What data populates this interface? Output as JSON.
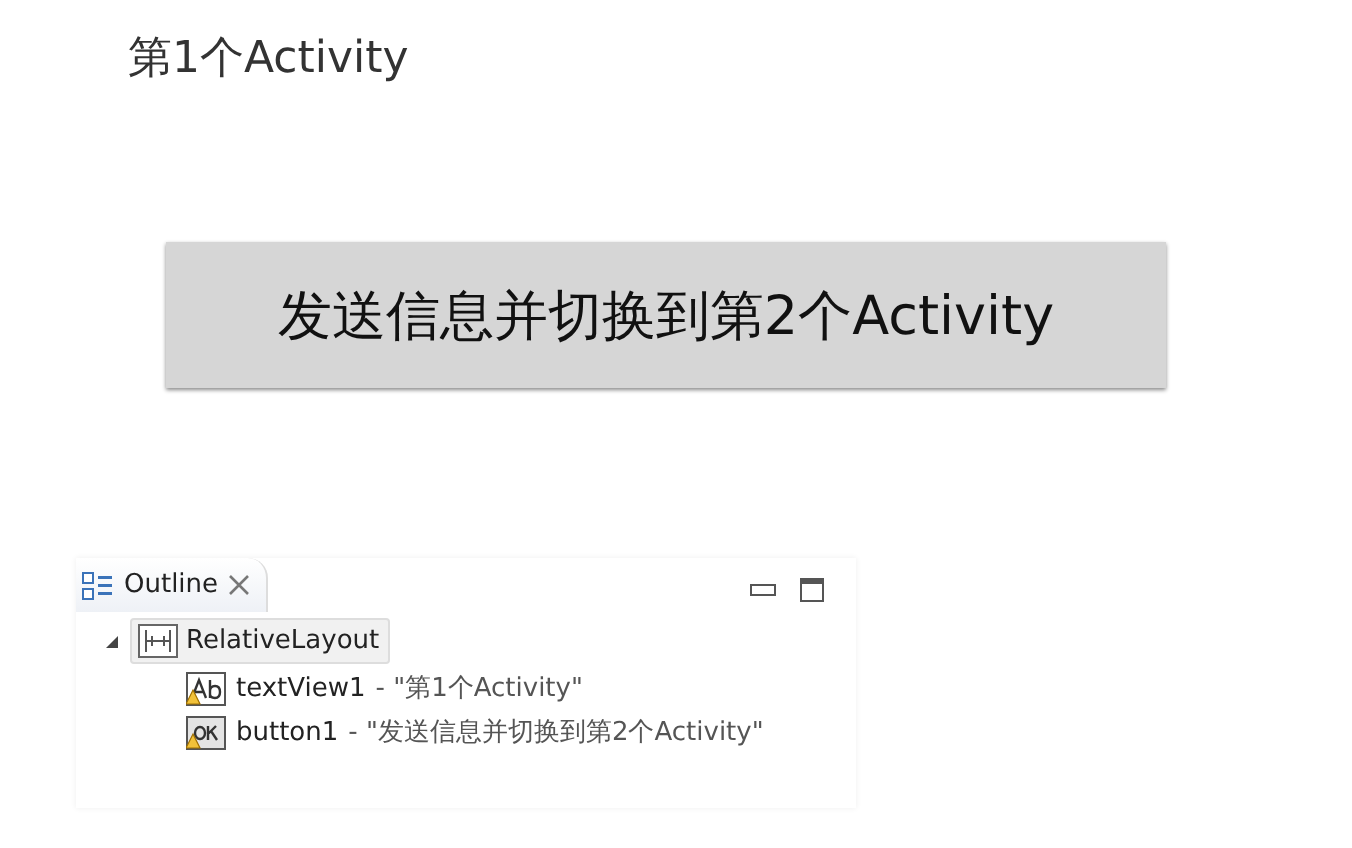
{
  "screen": {
    "title": "第1个Activity",
    "button": "发送信息并切换到第2个Activity"
  },
  "outline": {
    "tab": {
      "label": "Outline"
    },
    "tree": [
      {
        "label": "RelativeLayout",
        "kind": "layout",
        "expanded": true,
        "selected": true,
        "children": [
          {
            "label": "textView1",
            "detail": " - \"第1个Activity\"",
            "kind": "text",
            "warning": true,
            "selected": false
          },
          {
            "label": "button1",
            "detail": " - \"发送信息并切换到第2个Activity\"",
            "kind": "button",
            "warning": true,
            "selected": false
          }
        ]
      }
    ]
  }
}
